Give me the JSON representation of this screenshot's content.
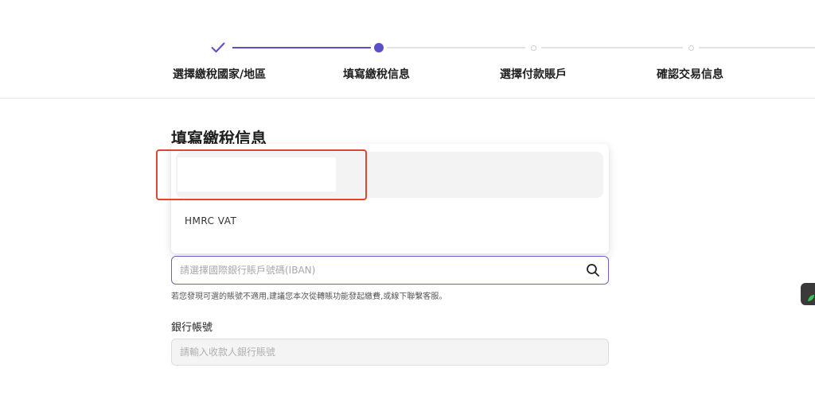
{
  "stepper": {
    "steps": [
      {
        "label": "選擇繳稅國家/地區",
        "state": "done"
      },
      {
        "label": "填寫繳稅信息",
        "state": "active"
      },
      {
        "label": "選擇付款賬戶",
        "state": "pending"
      },
      {
        "label": "確認交易信息",
        "state": "pending"
      }
    ]
  },
  "form": {
    "title": "填寫繳稅信息",
    "tax_type_dropdown": {
      "selected_option": "",
      "options": [
        "HMRC VAT"
      ]
    },
    "iban_search": {
      "placeholder": "請選擇國際銀行賬戶號碼(IBAN)",
      "value": "",
      "icon": "search-icon"
    },
    "hint": "若您發現可選的賬號不適用,建議您本次從轉賬功能發起繳費,或線下聯繫客服。",
    "bank_account": {
      "label": "銀行帳號",
      "placeholder": "請輸入收款人銀行賬號",
      "value": ""
    }
  },
  "colors": {
    "accent": "#5b4fc4",
    "highlight": "#e2442f"
  }
}
